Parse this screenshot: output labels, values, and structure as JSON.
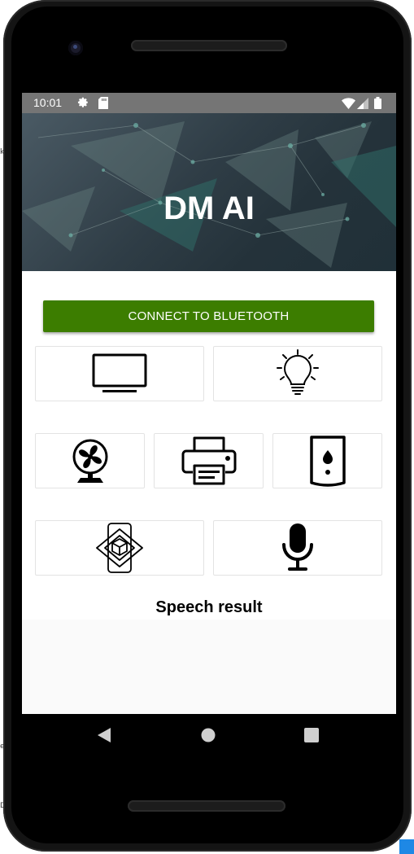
{
  "status_bar": {
    "time": "10:01",
    "left_icons": [
      "settings-icon",
      "sd-card-icon"
    ],
    "right_icons": [
      "wifi-icon",
      "signal-icon",
      "battery-icon"
    ],
    "background": "#757575"
  },
  "header": {
    "title": "DM AI"
  },
  "actions": {
    "connect_label": "CONNECT TO BLUETOOTH",
    "connect_color": "#3c7d00"
  },
  "devices": {
    "row1": [
      "tv-icon",
      "light-bulb-icon"
    ],
    "row2": [
      "fan-icon",
      "printer-icon",
      "water-heater-icon"
    ],
    "row3": [
      "ar-phone-icon",
      "microphone-icon"
    ]
  },
  "speech": {
    "label": "Speech result",
    "text": ""
  },
  "navigation": {
    "buttons": [
      "back-icon",
      "home-icon",
      "recents-icon"
    ]
  }
}
